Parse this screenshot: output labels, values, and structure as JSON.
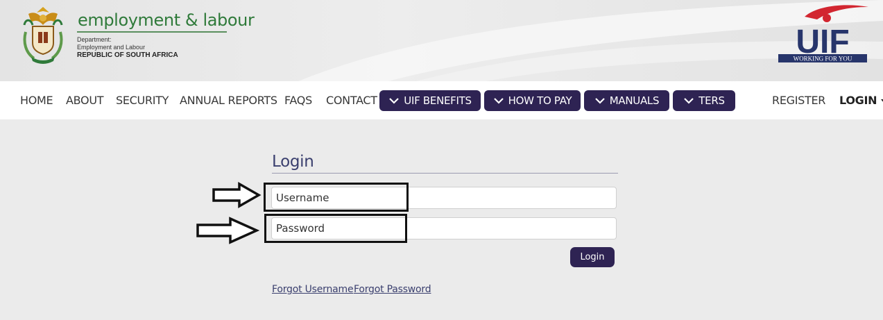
{
  "header": {
    "dept_name": "employment & labour",
    "dept_line1": "Department:",
    "dept_line2": "Employment and Labour",
    "dept_line3": "REPUBLIC OF SOUTH AFRICA",
    "brand_logo_text": "UIF",
    "brand_tagline": "WORKING FOR YOU",
    "colors": {
      "green": "#2f7a3a",
      "uif_navy": "#27356b",
      "uif_red": "#d22630"
    }
  },
  "nav": {
    "links": [
      "HOME",
      "ABOUT",
      "SECURITY",
      "ANNUAL REPORTS",
      "FAQS",
      "CONTACT"
    ],
    "dropdowns": [
      "UIF BENEFITS",
      "HOW TO PAY",
      "MANUALS",
      "TERS"
    ],
    "register": "REGISTER",
    "login": "LOGIN",
    "colors": {
      "pill": "#2e2353"
    }
  },
  "form": {
    "title": "Login",
    "username_placeholder": "Username",
    "password_placeholder": "Password",
    "submit": "Login",
    "forgot_username": "Forgot Username",
    "forgot_password": "Forgot Password"
  }
}
